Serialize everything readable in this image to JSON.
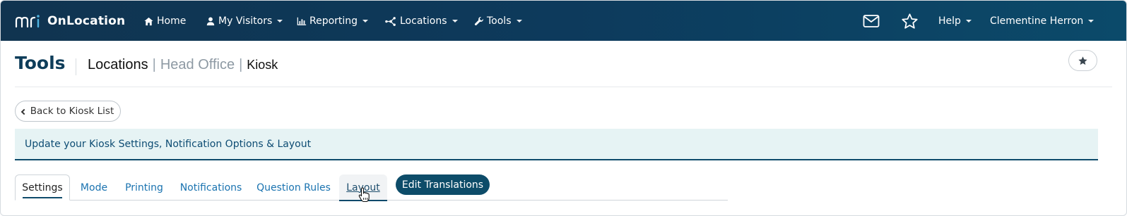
{
  "navbar": {
    "brand_mark": "mri",
    "brand_name": "OnLocation",
    "items": [
      {
        "label": "Home",
        "icon": "home-icon"
      },
      {
        "label": "My Visitors",
        "icon": "user-icon",
        "dropdown": true
      },
      {
        "label": "Reporting",
        "icon": "bar-chart-icon",
        "dropdown": true
      },
      {
        "label": "Locations",
        "icon": "network-icon",
        "dropdown": true
      },
      {
        "label": "Tools",
        "icon": "wrench-icon",
        "dropdown": true
      }
    ],
    "right": {
      "mail_icon": "envelope-icon",
      "star_icon": "star-icon",
      "help_label": "Help",
      "user_name": "Clementine Herron"
    },
    "colors": {
      "background_start": "#103450",
      "background_end": "#0b4a6a",
      "brand_accent": "#4fb3e0"
    }
  },
  "header": {
    "title": "Tools",
    "breadcrumb": {
      "section": "Locations",
      "separator": "|",
      "location": "Head Office",
      "page": "Kiosk"
    },
    "favorite_icon": "star-icon"
  },
  "back_button": {
    "label": "Back to Kiosk List"
  },
  "banner": {
    "text": "Update your Kiosk Settings, Notification Options & Layout"
  },
  "tabs": [
    {
      "label": "Settings",
      "active": true
    },
    {
      "label": "Mode"
    },
    {
      "label": "Printing"
    },
    {
      "label": "Notifications"
    },
    {
      "label": "Question Rules"
    },
    {
      "label": "Layout",
      "hovered": true
    }
  ],
  "edit_translations": {
    "label": "Edit Translations"
  },
  "colors": {
    "title": "#0e3d5a",
    "link": "#1a73b0",
    "banner_bg": "#e6f3f4",
    "banner_text": "#0d4c73",
    "primary_button": "#0d4c69"
  }
}
